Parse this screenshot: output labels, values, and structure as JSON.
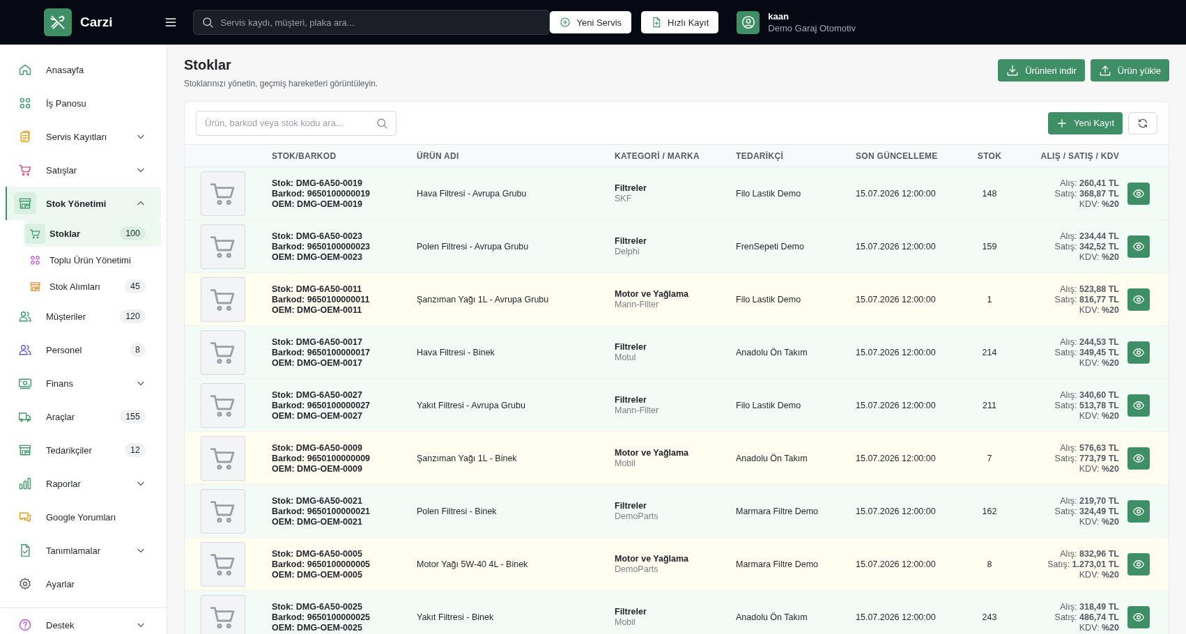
{
  "header": {
    "app_name": "Carzi",
    "search": {
      "placeholder": "Servis kaydı, müşteri, plaka ara..."
    },
    "buttons": [
      "Yeni Servis",
      "Hızlı Kayıt"
    ],
    "user": {
      "name": "kaan",
      "company": "Demo Garaj Otomotiv"
    }
  },
  "sidebar": {
    "items": [
      {
        "label": "Anasayfa",
        "selected": false
      },
      {
        "label": "İş Panosu",
        "selected": false
      },
      {
        "label": "Servis Kayıtları",
        "selected": false,
        "expanded": false
      },
      {
        "label": "Satışlar",
        "selected": false,
        "expanded": false
      },
      {
        "label": "Stok Yönetimi",
        "selected": true,
        "expanded": true,
        "children": [
          {
            "label": "Stoklar",
            "selected": true,
            "badge": "100"
          },
          {
            "label": "Toplu Ürün Yönetimi",
            "selected": false
          },
          {
            "label": "Stok Alımları",
            "selected": false,
            "badge": "45"
          }
        ]
      },
      {
        "label": "Müşteriler",
        "selected": false,
        "badge": "120"
      },
      {
        "label": "Personel",
        "selected": false,
        "badge": "8"
      },
      {
        "label": "Finans",
        "selected": false,
        "expanded": false
      },
      {
        "label": "Araçlar",
        "selected": false,
        "badge": "155"
      },
      {
        "label": "Tedarikçiler",
        "selected": false,
        "badge": "12"
      },
      {
        "label": "Raporlar",
        "selected": false,
        "expanded": false
      },
      {
        "label": "Google Yorumları",
        "selected": false
      },
      {
        "label": "Tanımlamalar",
        "selected": false,
        "expanded": false
      },
      {
        "label": "Ayarlar",
        "selected": false
      }
    ],
    "footer_items": [
      {
        "label": "Destek",
        "selected": false,
        "expanded": false
      }
    ]
  },
  "page": {
    "title": "Stoklar",
    "subtitle": "Stoklarınızı yönetin, geçmiş hareketleri görüntüleyin.",
    "actions": [
      "Ürünleri indir",
      "Ürün yükle"
    ]
  },
  "table": {
    "search": {
      "placeholder": "Ürün, barkod veya stok kodu ara..."
    },
    "new_button": "Yeni Kayıt",
    "columns": [
      "STOK/BARKOD",
      "ÜRÜN ADI",
      "KATEGORİ / MARKA",
      "TEDARİKÇİ",
      "SON GÜNCELLEME",
      "STOK",
      "ALIŞ / SATIŞ / KDV"
    ],
    "rows": [
      {
        "stok": "Stok: DMG-6A50-0019",
        "barkod": "Barkod: 9650100000019",
        "oem": "OEM: DMG-OEM-0019",
        "name": "Hava Filtresi - Avrupa Grubu",
        "category": "Filtreler",
        "brand": "SKF",
        "supplier": "Filo Lastik Demo",
        "updated": "15.07.2026 12:00:00",
        "stock": "148",
        "low_stock": false,
        "buy": "Alış: **260,41 TL**",
        "sell": "Satış: **368,87 TL**",
        "vat": "KDV: **%20**"
      },
      {
        "stok": "Stok: DMG-6A50-0023",
        "barkod": "Barkod: 9650100000023",
        "oem": "OEM: DMG-OEM-0023",
        "name": "Polen Filtresi - Avrupa Grubu",
        "category": "Filtreler",
        "brand": "Delphi",
        "supplier": "FrenSepeti Demo",
        "updated": "15.07.2026 12:00:00",
        "stock": "159",
        "low_stock": false,
        "buy": "Alış: **234,44 TL**",
        "sell": "Satış: **342,52 TL**",
        "vat": "KDV: **%20**"
      },
      {
        "stok": "Stok: DMG-6A50-0011",
        "barkod": "Barkod: 9650100000011",
        "oem": "OEM: DMG-OEM-0011",
        "name": "Şanzıman Yağı 1L - Avrupa Grubu",
        "category": "Motor ve Yağlama",
        "brand": "Mann-Filter",
        "supplier": "Filo Lastik Demo",
        "updated": "15.07.2026 12:00:00",
        "stock": "1",
        "low_stock": true,
        "buy": "Alış: **523,88 TL**",
        "sell": "Satış: **816,77 TL**",
        "vat": "KDV: **%20**"
      },
      {
        "stok": "Stok: DMG-6A50-0017",
        "barkod": "Barkod: 9650100000017",
        "oem": "OEM: DMG-OEM-0017",
        "name": "Hava Filtresi - Binek",
        "category": "Filtreler",
        "brand": "Motul",
        "supplier": "Anadolu Ön Takım",
        "updated": "15.07.2026 12:00:00",
        "stock": "214",
        "low_stock": false,
        "buy": "Alış: **244,53 TL**",
        "sell": "Satış: **349,45 TL**",
        "vat": "KDV: **%20**"
      },
      {
        "stok": "Stok: DMG-6A50-0027",
        "barkod": "Barkod: 9650100000027",
        "oem": "OEM: DMG-OEM-0027",
        "name": "Yakıt Filtresi - Avrupa Grubu",
        "category": "Filtreler",
        "brand": "Mann-Filter",
        "supplier": "Filo Lastik Demo",
        "updated": "15.07.2026 12:00:00",
        "stock": "211",
        "low_stock": false,
        "buy": "Alış: **340,60 TL**",
        "sell": "Satış: **513,78 TL**",
        "vat": "KDV: **%20**"
      },
      {
        "stok": "Stok: DMG-6A50-0009",
        "barkod": "Barkod: 9650100000009",
        "oem": "OEM: DMG-OEM-0009",
        "name": "Şanzıman Yağı 1L - Binek",
        "category": "Motor ve Yağlama",
        "brand": "Mobil",
        "supplier": "Anadolu Ön Takım",
        "updated": "15.07.2026 12:00:00",
        "stock": "7",
        "low_stock": true,
        "buy": "Alış: **576,63 TL**",
        "sell": "Satış: **773,79 TL**",
        "vat": "KDV: **%20**"
      },
      {
        "stok": "Stok: DMG-6A50-0021",
        "barkod": "Barkod: 9650100000021",
        "oem": "OEM: DMG-OEM-0021",
        "name": "Polen Filtresi - Binek",
        "category": "Filtreler",
        "brand": "DemoParts",
        "supplier": "Marmara Filtre Demo",
        "updated": "15.07.2026 12:00:00",
        "stock": "162",
        "low_stock": false,
        "buy": "Alış: **219,70 TL**",
        "sell": "Satış: **324,49 TL**",
        "vat": "KDV: **%20**"
      },
      {
        "stok": "Stok: DMG-6A50-0005",
        "barkod": "Barkod: 9650100000005",
        "oem": "OEM: DMG-OEM-0005",
        "name": "Motor Yağı 5W-40 4L - Binek",
        "category": "Motor ve Yağlama",
        "brand": "DemoParts",
        "supplier": "Marmara Filtre Demo",
        "updated": "15.07.2026 12:00:00",
        "stock": "8",
        "low_stock": true,
        "buy": "Alış: **832,96 TL**",
        "sell": "Satış: **1.273,01 TL**",
        "vat": "KDV: **%20**"
      },
      {
        "stok": "Stok: DMG-6A50-0025",
        "barkod": "Barkod: 9650100000025",
        "oem": "OEM: DMG-OEM-0025",
        "name": "Yakıt Filtresi - Binek",
        "category": "Filtreler",
        "brand": "Mobil",
        "supplier": "Anadolu Ön Takım",
        "updated": "15.07.2026 12:00:00",
        "stock": "243",
        "low_stock": false,
        "buy": "Alış: **318,49 TL**",
        "sell": "Satış: **486,74 TL**",
        "vat": "KDV: **%20**"
      }
    ]
  }
}
